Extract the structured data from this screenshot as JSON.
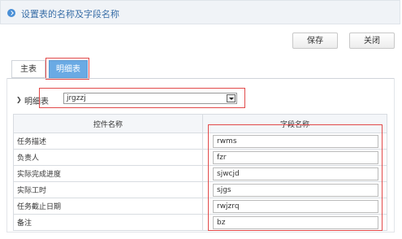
{
  "header": {
    "title": "设置表的名称及字段名称"
  },
  "toolbar": {
    "save_label": "保存",
    "close_label": "关闭"
  },
  "tabs": [
    {
      "label": "主表"
    },
    {
      "label": "明细表"
    }
  ],
  "detail_table": {
    "label": "明细表",
    "selected": "jrgzzj"
  },
  "grid": {
    "headers": [
      "控件名称",
      "字段名称"
    ],
    "rows": [
      {
        "control": "任务描述",
        "field": "rwms"
      },
      {
        "control": "负责人",
        "field": "fzr"
      },
      {
        "control": "实际完成进度",
        "field": "sjwcjd"
      },
      {
        "control": "实际工时",
        "field": "sjgs"
      },
      {
        "control": "任务截止日期",
        "field": "rwjzrq"
      },
      {
        "control": "备注",
        "field": "bz"
      }
    ]
  },
  "colors": {
    "accent": "#4a8fd6",
    "active_tab": "#6aaae4",
    "highlight": "#e24a4a"
  }
}
